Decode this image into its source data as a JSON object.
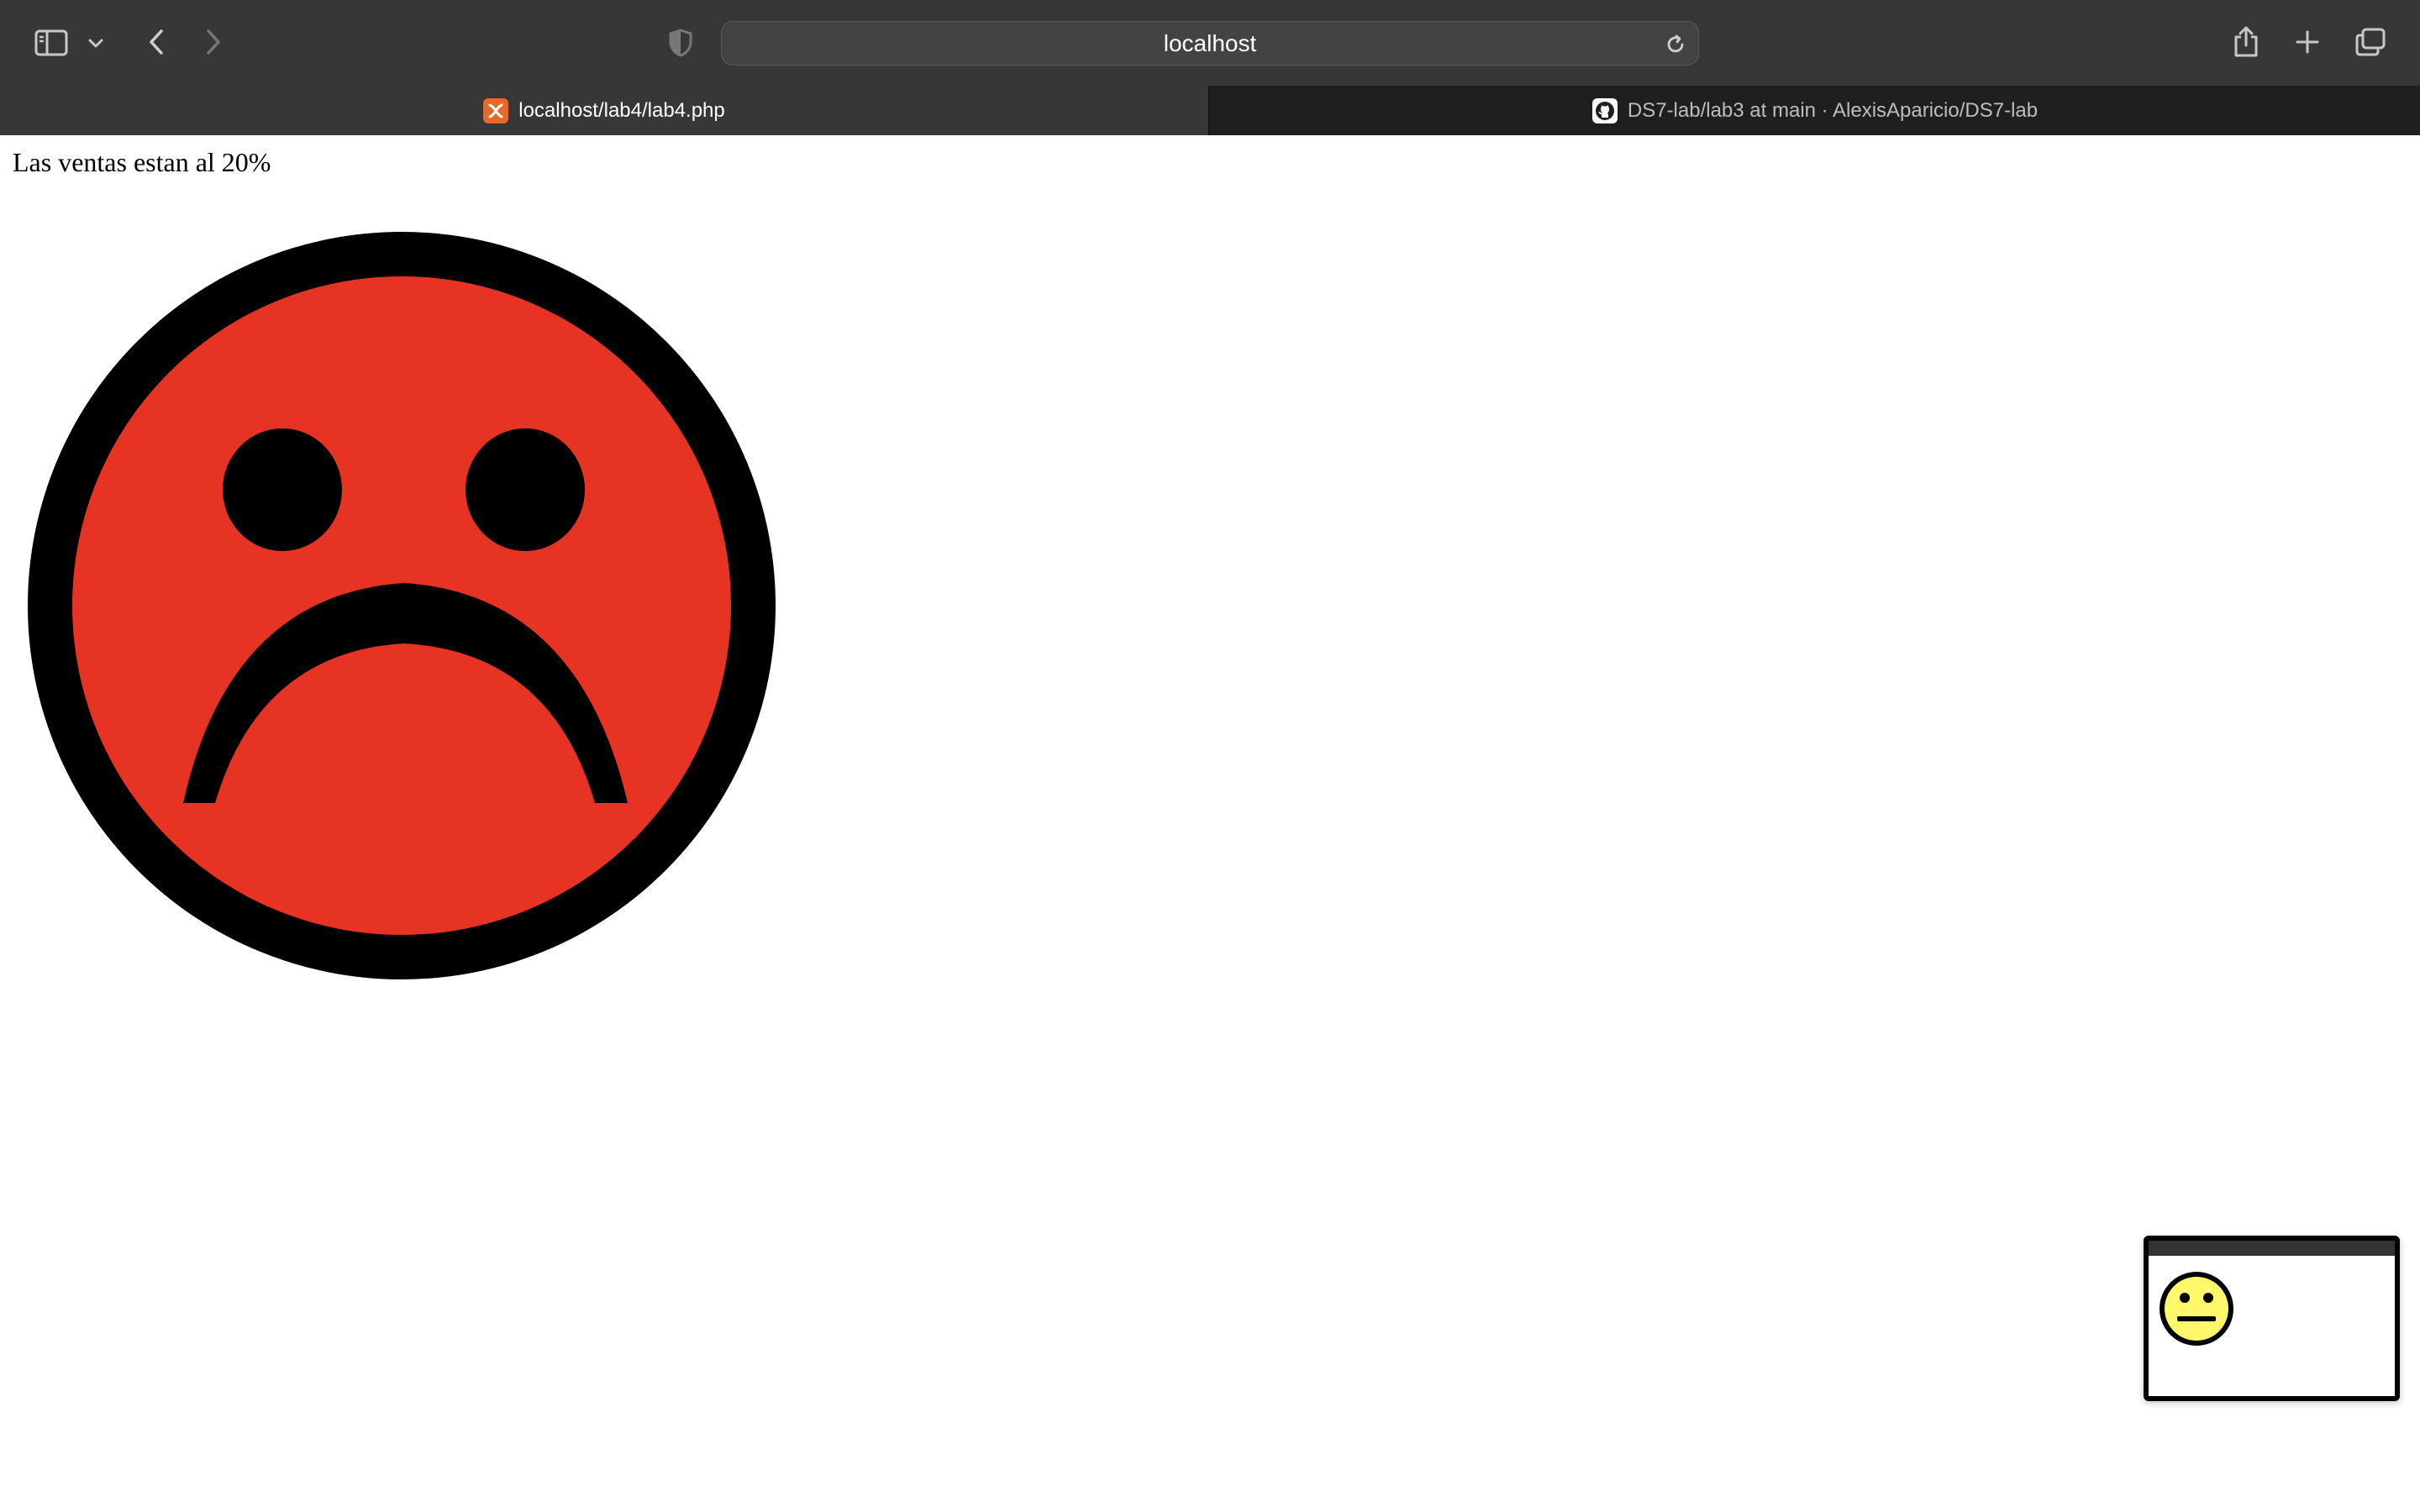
{
  "browser": {
    "address": "localhost",
    "tabs": [
      {
        "label": "localhost/lab4/lab4.php",
        "active": true,
        "icon": "xampp-icon"
      },
      {
        "label": "DS7-lab/lab3 at main · AlexisAparicio/DS7-lab",
        "active": false,
        "icon": "github-icon"
      }
    ]
  },
  "page": {
    "sales_text": "Las ventas estan al 20%",
    "face_mood": "sad",
    "face_color": "#e63323"
  },
  "thumbnail": {
    "face_mood": "neutral",
    "face_color": "#fff86a"
  }
}
